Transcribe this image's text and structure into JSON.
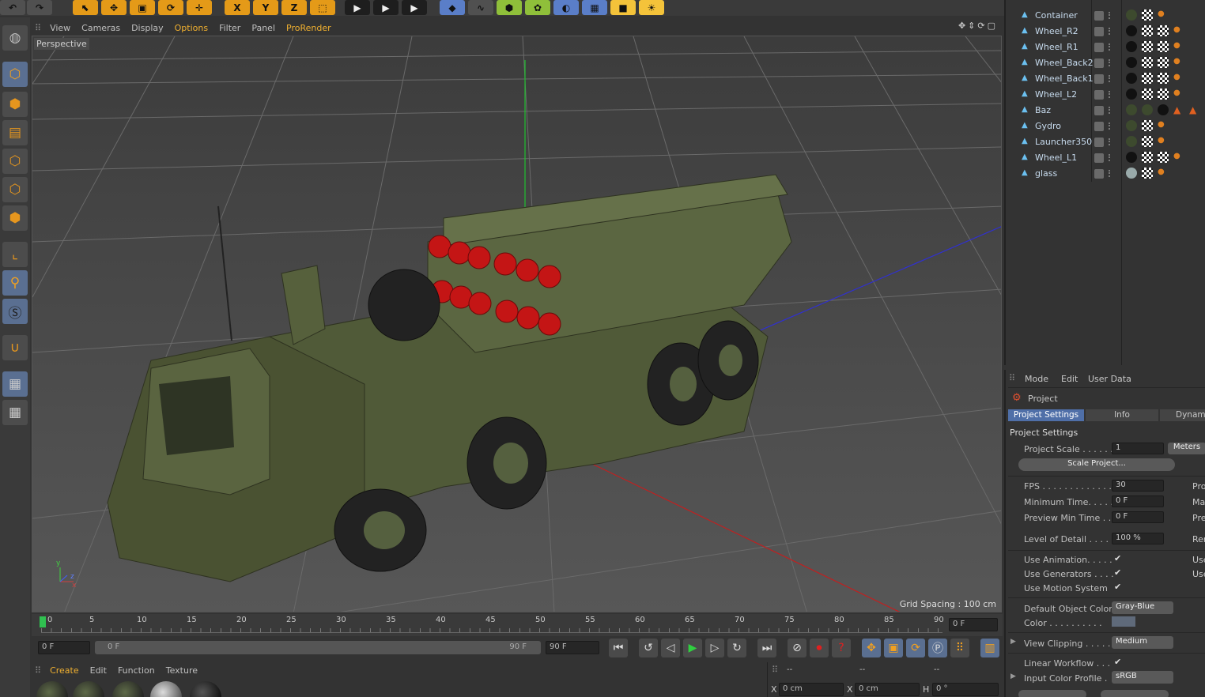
{
  "top_toolbar": {
    "icons": [
      "undo-icon",
      "move-icon",
      "scale-icon",
      "rotate-icon",
      "last-tool-icon",
      "x-axis-icon",
      "y-axis-icon",
      "z-axis-icon",
      "coord-system-icon",
      "render-view-icon",
      "render-picture-viewer-icon",
      "render-settings-icon",
      "cube-icon",
      "spline-pen-icon",
      "subdivision-icon",
      "mograph-icon",
      "deformer-icon",
      "scene-floor-icon",
      "camera-icon",
      "light-icon"
    ],
    "x_label": "X",
    "y_label": "Y",
    "z_label": "Z"
  },
  "viewport": {
    "menu": [
      "View",
      "Cameras",
      "Display",
      "Options",
      "Filter",
      "Panel",
      "ProRender"
    ],
    "highlighted_menu": "Options",
    "camera_label": "Perspective",
    "grid_spacing": "Grid Spacing : 100 cm",
    "axis_x": "x",
    "axis_y": "y",
    "axis_z": "z"
  },
  "timeline": {
    "ticks": [
      "0",
      "5",
      "10",
      "15",
      "20",
      "25",
      "30",
      "35",
      "40",
      "45",
      "50",
      "55",
      "60",
      "65",
      "70",
      "75",
      "80",
      "85",
      "90"
    ],
    "current_frame": "0 F",
    "start_field": "0 F",
    "range_start": "0 F",
    "range_end": "90 F",
    "end_field": "90 F"
  },
  "material_manager": {
    "menu": [
      "Create",
      "Edit",
      "Function",
      "Texture"
    ],
    "highlighted_menu": "Create"
  },
  "coordinates": {
    "header_1": "--",
    "header_2": "--",
    "header_3": "--",
    "x_label": "X",
    "x_value": "0 cm",
    "x2_label": "X",
    "x2_value": "0 cm",
    "h_label": "H",
    "h_value": "0 °"
  },
  "object_manager": {
    "objects": [
      {
        "name": "Container"
      },
      {
        "name": "Wheel_R2"
      },
      {
        "name": "Wheel_R1"
      },
      {
        "name": "Wheel_Back2"
      },
      {
        "name": "Wheel_Back1"
      },
      {
        "name": "Wheel_L2"
      },
      {
        "name": "Baz"
      },
      {
        "name": "Gydro"
      },
      {
        "name": "Launcher350"
      },
      {
        "name": "Wheel_L1"
      },
      {
        "name": "glass"
      }
    ]
  },
  "attribute_manager": {
    "menu": [
      "Mode",
      "Edit",
      "User Data"
    ],
    "object_title": "Project",
    "tabs": [
      "Project Settings",
      "Info",
      "Dynam"
    ],
    "active_tab": "Project Settings",
    "section_title": "Project Settings",
    "project_scale_label": "Project Scale . . . . . .",
    "project_scale_value": "1",
    "project_scale_unit": "Meters",
    "scale_project_button": "Scale Project...",
    "fps_label": "FPS . . . . . . . . . . . . . .",
    "fps_value": "30",
    "min_time_label": "Minimum Time. . . . .",
    "min_time_value": "0 F",
    "preview_min_label": "Preview Min Time . .",
    "preview_min_value": "0 F",
    "lod_label": "Level of Detail . . . . .",
    "lod_value": "100 %",
    "use_animation_label": "Use Animation. . . . .",
    "use_generators_label": "Use Generators . . . .",
    "use_motion_label": "Use Motion System",
    "default_color_label": "Default Object Color",
    "default_color_value": "Gray-Blue",
    "color_label": "Color . . . . . . . . . .",
    "view_clipping_label": "View Clipping . . . . .",
    "view_clipping_value": "Medium",
    "linear_workflow_label": "Linear Workflow . . .",
    "input_profile_label": "Input Color Profile .",
    "input_profile_value": "sRGB",
    "right_col": [
      "Pro",
      "Max",
      "Prev",
      "Ren",
      "Use",
      "Use"
    ],
    "checkmark": "✔"
  }
}
